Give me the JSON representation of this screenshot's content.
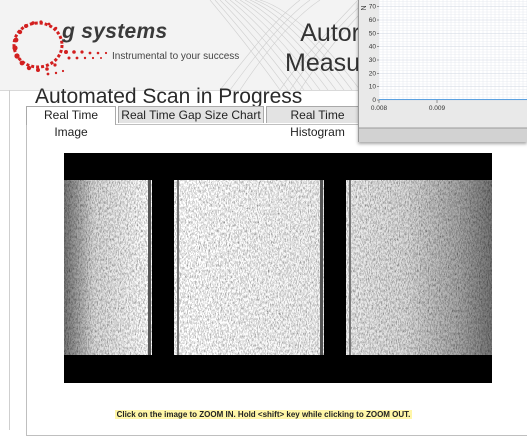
{
  "header": {
    "brand": "g systems",
    "tagline": "Instrumental to your success",
    "title_line1": "Autor",
    "title_line2": "Measur"
  },
  "scan": {
    "title": "Automated Scan in Progress",
    "hint": "Click on the image to ZOOM IN.  Hold <shift> key while clicking to ZOOM OUT."
  },
  "tabs": [
    {
      "label": "Real Time Image",
      "active": true
    },
    {
      "label": "Real Time Gap Size Chart",
      "active": false
    },
    {
      "label": "Real Time Histogram",
      "active": false
    }
  ],
  "chart_data": {
    "type": "line",
    "ylabel": "N",
    "yticks": [
      0,
      10,
      20,
      30,
      40,
      50,
      60,
      70
    ],
    "xticks": [
      "0.008",
      "0.009"
    ],
    "ylim": [
      0,
      75
    ],
    "grid": true
  },
  "colors": {
    "header_bg": "#f3f3f3",
    "logo_red": "#d21f1f",
    "hint_bg": "#fff6a8"
  }
}
